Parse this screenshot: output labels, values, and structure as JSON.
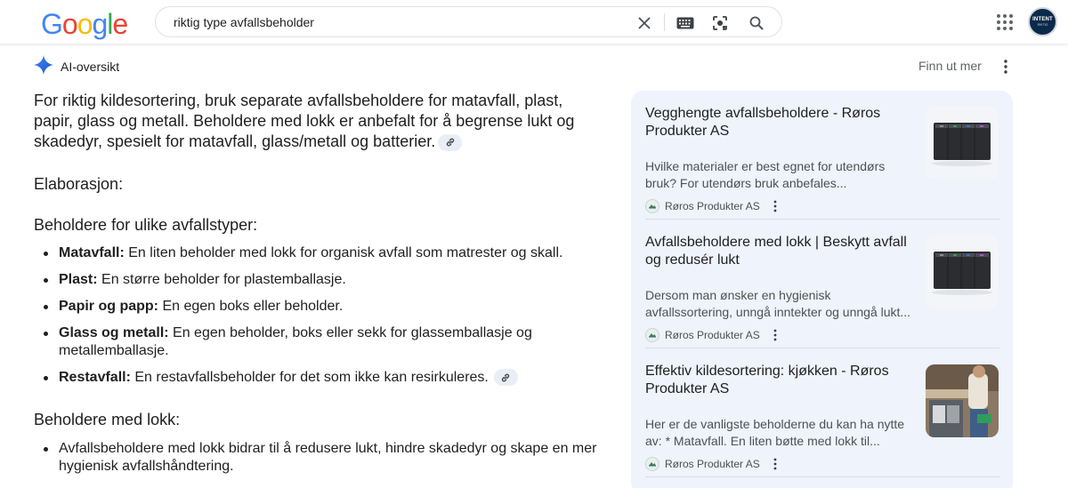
{
  "header": {
    "logo": [
      "G",
      "o",
      "o",
      "g",
      "l",
      "e"
    ],
    "search_value": "riktig type avfallsbeholder",
    "avatar_text": "INTENT",
    "avatar_subtext": "RIKTIG"
  },
  "overview": {
    "title": "AI-oversikt",
    "learn_more": "Finn ut mer",
    "intro": "For riktig kildesortering, bruk separate avfallsbeholdere for matavfall, plast, papir, glass og metall. Beholdere med lokk er anbefalt for å begrense lukt og skadedyr, spesielt for matavfall, glass/metall og batterier.",
    "heading_elaboration": "Elaborasjon:",
    "heading_types": "Beholdere for ulike avfallstyper:",
    "types": [
      {
        "term": "Matavfall:",
        "text": " En liten beholder med lokk for organisk avfall som matrester og skall."
      },
      {
        "term": "Plast:",
        "text": " En større beholder for plastemballasje."
      },
      {
        "term": "Papir og papp:",
        "text": " En egen boks eller beholder."
      },
      {
        "term": "Glass og metall:",
        "text": " En egen beholder, boks eller sekk for glassemballasje og metallemballasje."
      },
      {
        "term": "Restavfall:",
        "text": " En restavfallsbeholder for det som ikke kan resirkuleres."
      }
    ],
    "heading_lids": "Beholdere med lokk:",
    "lids": [
      "Avfallsbeholdere med lokk bidrar til å redusere lukt, hindre skadedyr og skape en mer hygienisk avfallshåndtering."
    ]
  },
  "sources": [
    {
      "title": "Vegghengte avfallsbeholdere - Røros Produkter AS",
      "snippet": "Hvilke materialer er best egnet for utendørs bruk? For utendørs bruk anbefales...",
      "site": "Røros Produkter AS"
    },
    {
      "title": "Avfallsbeholdere med lokk | Beskytt avfall og redusér lukt",
      "snippet": "Dersom man ønsker en hygienisk avfallssortering, unngå inntekter og unngå lukt...",
      "site": "Røros Produkter AS"
    },
    {
      "title": "Effektiv kildesortering: kjøkken - Røros Produkter AS",
      "snippet": "Her er de vanligste beholderne du kan ha nytte av: * Matavfall. En liten bøtte med lokk til...",
      "site": "Røros Produkter AS"
    }
  ],
  "colors": {
    "blue": "#4285f4",
    "red": "#ea4335",
    "yellow": "#fbbc05",
    "green": "#34a853",
    "panel_bg": "#eef3fc"
  },
  "icons": [
    "clear-icon",
    "keyboard-icon",
    "lens-icon",
    "search-icon",
    "apps-icon",
    "sparkle-icon",
    "more-vert-icon",
    "link-icon"
  ]
}
